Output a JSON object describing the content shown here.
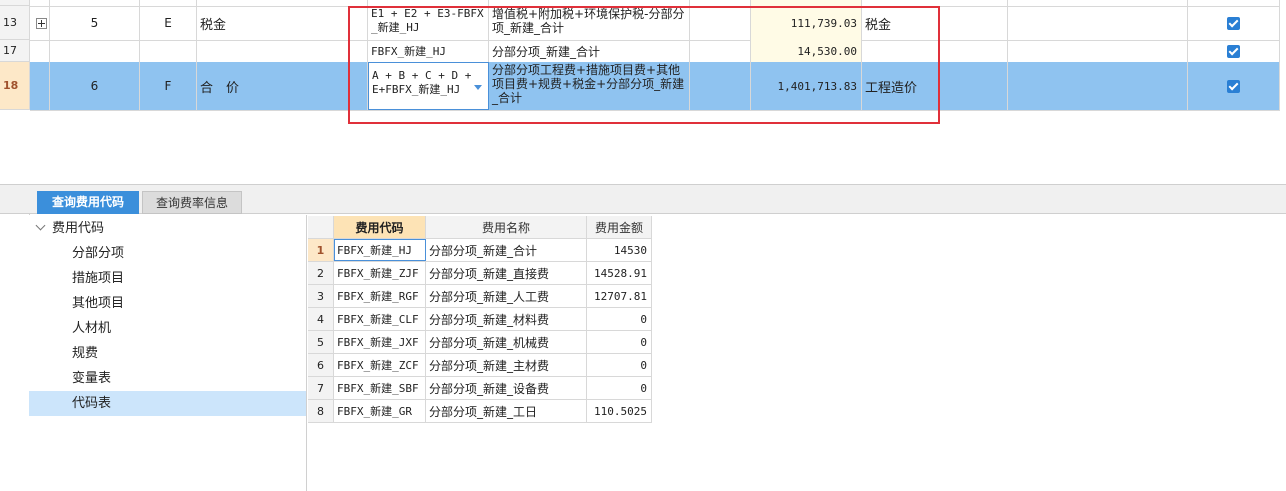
{
  "upper_rows": [
    {
      "row": "13",
      "seq": "5",
      "code": "E",
      "name": "税金",
      "formula": "E1 + E2 + E3-FBFX_新建_HJ",
      "basis": "增值税+附加税+环境保护税-分部分项_新建_合计",
      "amount": "111,739.03",
      "type": "税金",
      "expandable": true
    },
    {
      "row": "17",
      "seq": "",
      "code": "",
      "name": "",
      "formula": "FBFX_新建_HJ",
      "basis": "分部分项_新建_合计",
      "amount": "14,530.00",
      "type": "",
      "expandable": false
    },
    {
      "row": "18",
      "seq": "6",
      "code": "F",
      "name": "合　价",
      "formula": "A + B + C + D + E+FBFX_新建_HJ",
      "basis": "分部分项工程费+措施项目费+其他项目费+规费+税金+分部分项_新建_合计",
      "amount": "1,401,713.83",
      "type": "工程造价",
      "expandable": false
    }
  ],
  "tabs": {
    "active": "查询费用代码",
    "inactive": "查询费率信息"
  },
  "tree": {
    "root": "费用代码",
    "children": [
      "分部分项",
      "措施项目",
      "其他项目",
      "人材机",
      "规费",
      "变量表",
      "代码表"
    ],
    "selected": "代码表"
  },
  "lower_table": {
    "headers": [
      "费用代码",
      "费用名称",
      "费用金额"
    ],
    "rows": [
      {
        "n": "1",
        "code": "FBFX_新建_HJ",
        "name": "分部分项_新建_合计",
        "amount": "14530"
      },
      {
        "n": "2",
        "code": "FBFX_新建_ZJF",
        "name": "分部分项_新建_直接费",
        "amount": "14528.91"
      },
      {
        "n": "3",
        "code": "FBFX_新建_RGF",
        "name": "分部分项_新建_人工费",
        "amount": "12707.81"
      },
      {
        "n": "4",
        "code": "FBFX_新建_CLF",
        "name": "分部分项_新建_材料费",
        "amount": "0"
      },
      {
        "n": "5",
        "code": "FBFX_新建_JXF",
        "name": "分部分项_新建_机械费",
        "amount": "0"
      },
      {
        "n": "6",
        "code": "FBFX_新建_ZCF",
        "name": "分部分项_新建_主材费",
        "amount": "0"
      },
      {
        "n": "7",
        "code": "FBFX_新建_SBF",
        "name": "分部分项_新建_设备费",
        "amount": "0"
      },
      {
        "n": "8",
        "code": "FBFX_新建_GR",
        "name": "分部分项_新建_工日",
        "amount": "110.5025"
      }
    ]
  },
  "colors": {
    "selection": "#8fc3f0",
    "accent": "#3b8fdb",
    "highlight_box": "#e0303a"
  }
}
